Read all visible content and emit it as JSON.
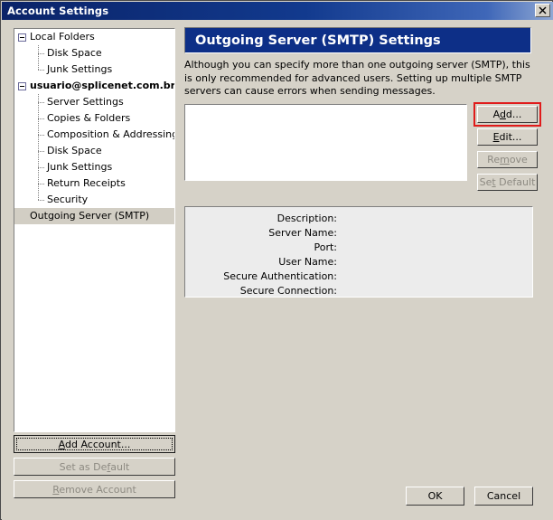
{
  "window": {
    "title": "Account Settings",
    "close_icon": "close-icon"
  },
  "tree": {
    "items": [
      {
        "label": "Local Folders",
        "level": "root",
        "bold": false,
        "expander": "minus",
        "selected": false
      },
      {
        "label": "Disk Space",
        "level": "child",
        "bold": false,
        "expander": "none",
        "selected": false
      },
      {
        "label": "Junk Settings",
        "level": "child",
        "bold": false,
        "expander": "none",
        "selected": false
      },
      {
        "label": "usuario@splicenet.com.br",
        "level": "root",
        "bold": true,
        "expander": "minus",
        "selected": false
      },
      {
        "label": "Server Settings",
        "level": "child",
        "bold": false,
        "expander": "none",
        "selected": false
      },
      {
        "label": "Copies & Folders",
        "level": "child",
        "bold": false,
        "expander": "none",
        "selected": false
      },
      {
        "label": "Composition & Addressing",
        "level": "child",
        "bold": false,
        "expander": "none",
        "selected": false
      },
      {
        "label": "Disk Space",
        "level": "child",
        "bold": false,
        "expander": "none",
        "selected": false
      },
      {
        "label": "Junk Settings",
        "level": "child",
        "bold": false,
        "expander": "none",
        "selected": false
      },
      {
        "label": "Return Receipts",
        "level": "child",
        "bold": false,
        "expander": "none",
        "selected": false
      },
      {
        "label": "Security",
        "level": "child",
        "bold": false,
        "expander": "none",
        "selected": false
      },
      {
        "label": "Outgoing Server (SMTP)",
        "level": "flat",
        "bold": false,
        "expander": "none",
        "selected": true
      }
    ]
  },
  "account_buttons": {
    "add_account": "Add Account...",
    "add_account_accesskey": "A",
    "set_as_default": "Set as Default",
    "set_as_default_accesskey": "f",
    "remove_account": "Remove Account",
    "remove_account_accesskey": "R",
    "set_as_default_disabled": true,
    "remove_account_disabled": true
  },
  "panel": {
    "header": "Outgoing Server (SMTP) Settings",
    "description": "Although you can specify more than one outgoing server (SMTP), this is only recommended for advanced users. Setting up multiple SMTP servers can cause errors when sending messages.",
    "server_list_items": []
  },
  "server_buttons": {
    "add": "Add...",
    "add_accesskey": "d",
    "edit": "Edit...",
    "edit_accesskey": "E",
    "remove": "Remove",
    "remove_accesskey": "m",
    "set_default": "Set Default",
    "set_default_accesskey": "t",
    "remove_disabled": true,
    "set_default_disabled": true,
    "highlight_color": "#e01b1b",
    "highlighted_button": "add"
  },
  "details": {
    "rows": [
      {
        "label": "Description:",
        "value": ""
      },
      {
        "label": "Server Name:",
        "value": ""
      },
      {
        "label": "Port:",
        "value": ""
      },
      {
        "label": "User Name:",
        "value": ""
      },
      {
        "label": "Secure Authentication:",
        "value": ""
      },
      {
        "label": "Secure Connection:",
        "value": ""
      }
    ]
  },
  "dialog_buttons": {
    "ok": "OK",
    "cancel": "Cancel"
  },
  "colors": {
    "titlebar_start": "#0a2368",
    "titlebar_end": "#8fa8d4",
    "header_band": "#0d2f87",
    "dialog_face": "#d6d2c8",
    "selection": "#d2cec4",
    "annotation_red": "#e01b1b"
  }
}
